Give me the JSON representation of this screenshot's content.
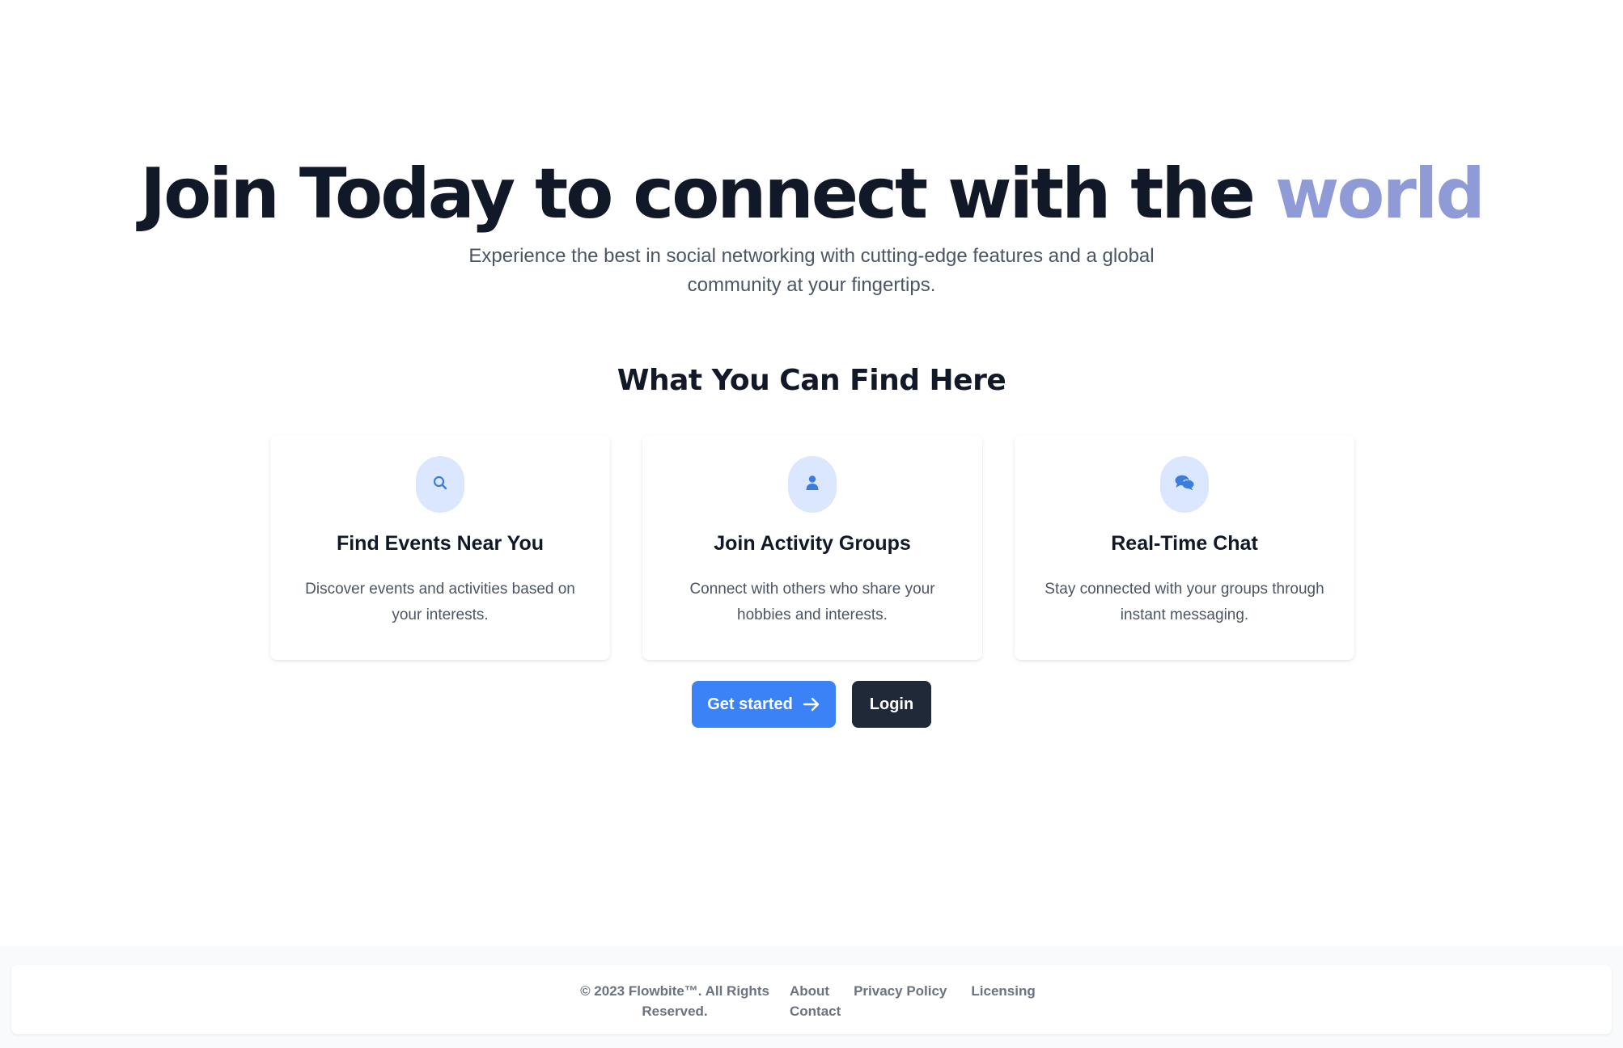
{
  "hero": {
    "title_main": "Join Today to connect with the ",
    "title_accent": "world",
    "subtitle": "Experience the best in social networking with cutting-edge features and a global community at your fingertips."
  },
  "features": {
    "title": "What You Can Find Here",
    "items": [
      {
        "icon": "search-icon",
        "title": "Find Events Near You",
        "description": "Discover events and activities based on your interests."
      },
      {
        "icon": "user-icon",
        "title": "Join Activity Groups",
        "description": "Connect with others who share your hobbies and interests."
      },
      {
        "icon": "chat-icon",
        "title": "Real-Time Chat",
        "description": "Stay connected with your groups through instant messaging."
      }
    ]
  },
  "actions": {
    "get_started_label": "Get started",
    "login_label": "Login"
  },
  "footer": {
    "copyright": "© 2023 Flowbite™. All Rights Reserved.",
    "links": [
      "About",
      "Privacy Policy",
      "Licensing",
      "Contact"
    ]
  },
  "colors": {
    "accent": "#8e9bd6",
    "primary_button": "#3b82f6",
    "dark_button": "#1f2937",
    "icon_circle_bg": "#dbe7fe",
    "icon_fg": "#3b7ddd"
  }
}
